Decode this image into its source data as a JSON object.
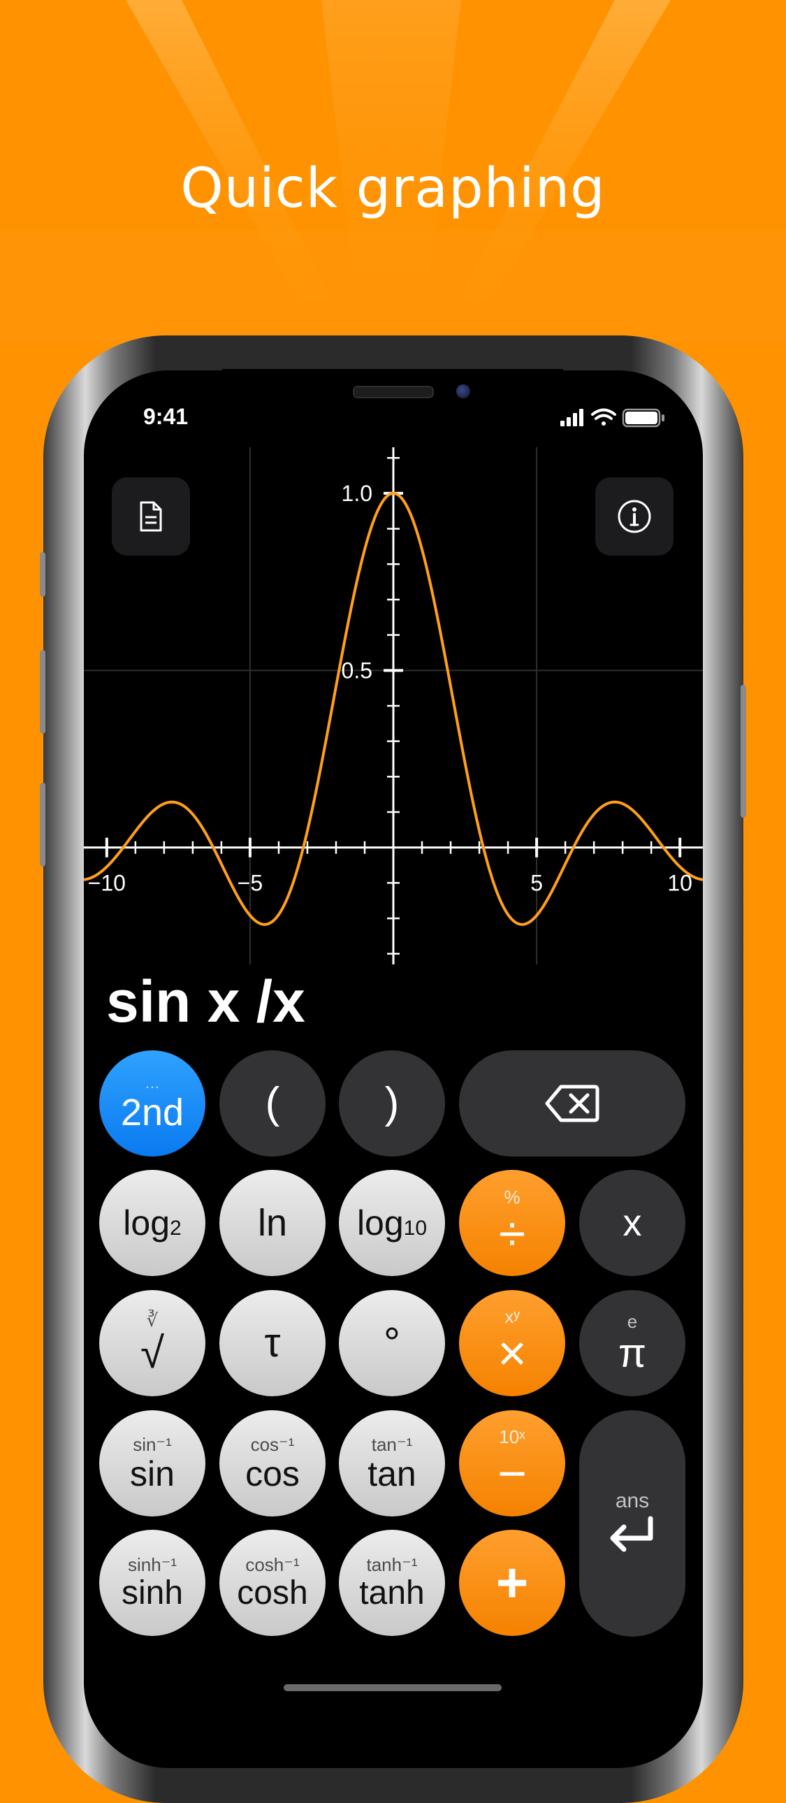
{
  "headline": "Quick graphing",
  "status": {
    "time": "9:41"
  },
  "graph": {
    "function": "sin x /x",
    "tick_labels_y": [
      "1.0",
      "0.5"
    ],
    "tick_labels_x": [
      "−10",
      "−5",
      "5",
      "10"
    ],
    "curve_color": "#ff9f1a"
  },
  "chart_data": {
    "type": "line",
    "series": [
      {
        "name": "",
        "fn": "sin(x)/x"
      }
    ],
    "xlim": [
      -10.8,
      10.8
    ],
    "ylim": [
      -0.33,
      1.13
    ],
    "x_ticks": [
      -10,
      -5,
      5,
      10
    ],
    "y_ticks": [
      0.5,
      1.0
    ]
  },
  "expression": "sin x /x",
  "buttons": {
    "notes_icon": "document-icon",
    "info_icon": "info-icon"
  },
  "keys": {
    "second": {
      "label": "2nd",
      "sup": "…"
    },
    "open_paren": {
      "label": "("
    },
    "close_paren": {
      "label": ")"
    },
    "log2": {
      "label": "log",
      "sub": "2"
    },
    "ln": {
      "label": "ln"
    },
    "log10": {
      "label": "log",
      "sub": "10"
    },
    "divide": {
      "label": "÷",
      "sup": "%"
    },
    "x": {
      "label": "x"
    },
    "sqrt": {
      "label": "√",
      "sup": "∛"
    },
    "tau": {
      "label": "τ"
    },
    "degree": {
      "label": "°"
    },
    "multiply": {
      "label": "×",
      "sup": "xʸ"
    },
    "pi": {
      "label": "π",
      "sup": "e"
    },
    "sin": {
      "label": "sin",
      "sup": "sin⁻¹"
    },
    "cos": {
      "label": "cos",
      "sup": "cos⁻¹"
    },
    "tan": {
      "label": "tan",
      "sup": "tan⁻¹"
    },
    "minus": {
      "label": "−",
      "sup": "10ˣ"
    },
    "enter": {
      "label": "↵",
      "sup": "ans"
    },
    "sinh": {
      "label": "sinh",
      "sup": "sinh⁻¹"
    },
    "cosh": {
      "label": "cosh",
      "sup": "cosh⁻¹"
    },
    "tanh": {
      "label": "tanh",
      "sup": "tanh⁻¹"
    },
    "plus": {
      "label": "+"
    }
  },
  "colors": {
    "background": "#ff9200",
    "accent_orange": "#f58200",
    "accent_blue": "#0a7af0"
  }
}
